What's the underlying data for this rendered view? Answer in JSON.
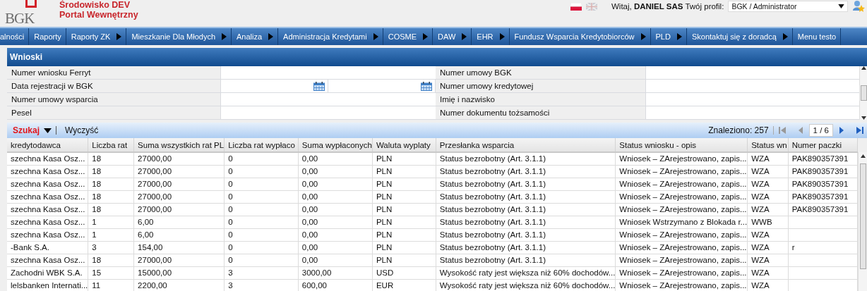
{
  "header": {
    "logo_text": "BGK",
    "env_title": "Środowisko DEV",
    "portal_title": "Portal Wewnętrzny",
    "greeting": "Witaj,",
    "user_name": "DANIEL SAS",
    "profile_label": "Twój profil:",
    "profile_value": "BGK / Administrator"
  },
  "menu": [
    {
      "label": "alności",
      "has_submenu": false
    },
    {
      "label": "Raporty",
      "has_submenu": false
    },
    {
      "label": "Raporty ZK",
      "has_submenu": true
    },
    {
      "label": "Mieszkanie Dla Młodych",
      "has_submenu": true
    },
    {
      "label": "Analiza",
      "has_submenu": true
    },
    {
      "label": "Administracja Kredytami",
      "has_submenu": true
    },
    {
      "label": "COSME",
      "has_submenu": true
    },
    {
      "label": "DAW",
      "has_submenu": true
    },
    {
      "label": "EHR",
      "has_submenu": true
    },
    {
      "label": "Fundusz Wsparcia Kredytobiorców",
      "has_submenu": true
    },
    {
      "label": "PLD",
      "has_submenu": true
    },
    {
      "label": "Skontaktuj się z doradcą",
      "has_submenu": true
    },
    {
      "label": "Menu testo",
      "has_submenu": false
    }
  ],
  "panel": {
    "title": "Wnioski"
  },
  "filters": [
    [
      {
        "label": "Numer wniosku Ferryt",
        "kind": "text"
      },
      {
        "label": "Numer umowy BGK",
        "kind": "text"
      }
    ],
    [
      {
        "label": "Data rejestracji w BGK",
        "kind": "date_range"
      },
      {
        "label": "Numer umowy kredytowej",
        "kind": "text"
      }
    ],
    [
      {
        "label": "Numer umowy wsparcia",
        "kind": "text"
      },
      {
        "label": "Imię i nazwisko",
        "kind": "text"
      }
    ],
    [
      {
        "label": "Pesel",
        "kind": "text"
      },
      {
        "label": "Numer dokumentu tożsamości",
        "kind": "text"
      }
    ]
  ],
  "toolbar": {
    "search": "Szukaj",
    "clear": "Wyczyść",
    "found": "Znaleziono: 257",
    "page": "1 / 6"
  },
  "table": {
    "columns": [
      "kredytodawca",
      "Liczba rat",
      "Suma wszystkich rat PL",
      "Liczba rat wypłaco",
      "Suma wypłaconych",
      "Waluta wyplaty",
      "Przesłanka wsparcia",
      "Status wniosku - opis",
      "Status wn",
      "Numer paczki"
    ],
    "rows": [
      [
        "szechna Kasa Osz...",
        "18",
        "27000,00",
        "0",
        "0,00",
        "PLN",
        "Status bezrobotny (Art. 3.1.1)",
        "Wniosek – ZArejestrowano, zapis...",
        "WZA",
        "PAK890357391"
      ],
      [
        "szechna Kasa Osz...",
        "18",
        "27000,00",
        "0",
        "0,00",
        "PLN",
        "Status bezrobotny (Art. 3.1.1)",
        "Wniosek – ZArejestrowano, zapis...",
        "WZA",
        "PAK890357391"
      ],
      [
        "szechna Kasa Osz...",
        "18",
        "27000,00",
        "0",
        "0,00",
        "PLN",
        "Status bezrobotny (Art. 3.1.1)",
        "Wniosek – ZArejestrowano, zapis...",
        "WZA",
        "PAK890357391"
      ],
      [
        "szechna Kasa Osz...",
        "18",
        "27000,00",
        "0",
        "0,00",
        "PLN",
        "Status bezrobotny (Art. 3.1.1)",
        "Wniosek – ZArejestrowano, zapis...",
        "WZA",
        "PAK890357391"
      ],
      [
        "szechna Kasa Osz...",
        "18",
        "27000,00",
        "0",
        "0,00",
        "PLN",
        "Status bezrobotny (Art. 3.1.1)",
        "Wniosek – ZArejestrowano, zapis...",
        "WZA",
        "PAK890357391"
      ],
      [
        "szechna Kasa Osz...",
        "1",
        "6,00",
        "0",
        "0,00",
        "PLN",
        "Status bezrobotny (Art. 3.1.1)",
        "Wniosek Wstrzymano z Blokada r...",
        "WWB",
        ""
      ],
      [
        "szechna Kasa Osz...",
        "1",
        "6,00",
        "0",
        "0,00",
        "PLN",
        "Status bezrobotny (Art. 3.1.1)",
        "Wniosek – ZArejestrowano, zapis...",
        "WZA",
        ""
      ],
      [
        "-Bank S.A.",
        "3",
        "154,00",
        "0",
        "0,00",
        "PLN",
        "Status bezrobotny (Art. 3.1.1)",
        "Wniosek – ZArejestrowano, zapis...",
        "WZA",
        "r"
      ],
      [
        "szechna Kasa Osz...",
        "18",
        "27000,00",
        "0",
        "0,00",
        "PLN",
        "Status bezrobotny (Art. 3.1.1)",
        "Wniosek – ZArejestrowano, zapis...",
        "WZA",
        ""
      ],
      [
        "Zachodni WBK S.A.",
        "15",
        "15000,00",
        "3",
        "3000,00",
        "USD",
        "Wysokość raty jest większa niż 60% dochodów...",
        "Wniosek – ZArejestrowano, zapis...",
        "WZA",
        ""
      ],
      [
        "lelsbanken Internati...",
        "11",
        "2200,00",
        "3",
        "600,00",
        "EUR",
        "Wysokość raty jest większa niż 60% dochodów...",
        "Wniosek – ZArejestrowano, zapis...",
        "WZA",
        ""
      ]
    ]
  }
}
